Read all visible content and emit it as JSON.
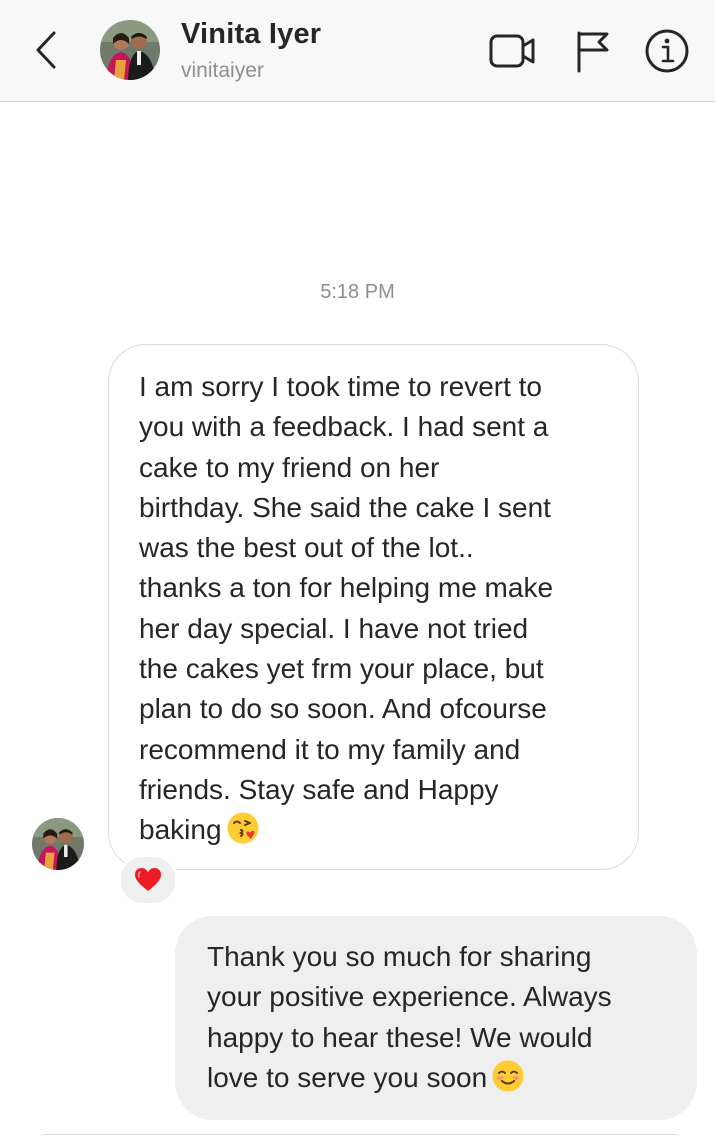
{
  "header": {
    "name": "Vinita Iyer",
    "username": "vinitaiyer",
    "icons": {
      "back": "chevron-left-icon",
      "video": "video-camera-icon",
      "flag": "flag-icon",
      "info": "info-icon"
    }
  },
  "conversation": {
    "timestamp": "5:18 PM",
    "incoming": {
      "lines": [
        "I am sorry I took time to revert to",
        "you with a feedback. I had sent a",
        "cake to my friend on her",
        "birthday. She said the cake I sent",
        "was the best out of the lot..",
        "thanks a ton for helping me make",
        "her day special. I have not tried",
        "the cakes yet frm your place, but",
        "plan to do so soon. And ofcourse",
        "recommend it to my family and",
        "friends. Stay safe and Happy",
        "baking"
      ],
      "emoji": "face-blowing-a-kiss-icon",
      "reaction": "heart-icon"
    },
    "outgoing": {
      "lines": [
        "Thank you so much for sharing",
        "your positive experience. Always",
        "happy to hear these! We would",
        "love to serve you soon"
      ],
      "emoji": "smiling-face-icon"
    }
  },
  "colors": {
    "header_bg": "#f8f8f8",
    "text": "#262626",
    "muted": "#8e8e8e",
    "bubble_border": "#dbdbdb",
    "outgoing_bubble": "#efefef",
    "heart": "#ed1c24"
  }
}
